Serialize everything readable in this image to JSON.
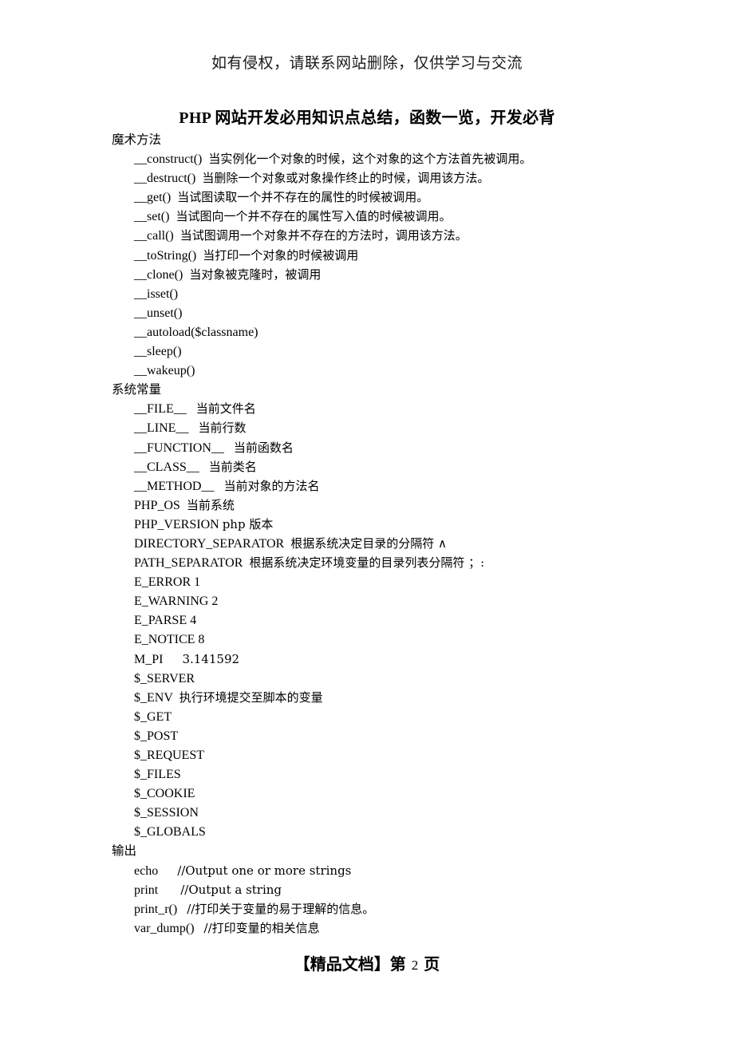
{
  "watermark": "如有侵权，请联系网站删除，仅供学习与交流",
  "title": "PHP 网站开发必用知识点总结，函数一览，开发必背",
  "sections": [
    {
      "heading": "魔术方法",
      "items": [
        {
          "term": "__construct()",
          "gap": "  ",
          "desc": "当实例化一个对象的时候，这个对象的这个方法首先被调用。"
        },
        {
          "term": "__destruct()",
          "gap": "  ",
          "desc": "当删除一个对象或对象操作终止的时候，调用该方法。"
        },
        {
          "term": "__get()",
          "gap": "  ",
          "desc": "当试图读取一个并不存在的属性的时候被调用。"
        },
        {
          "term": "__set()",
          "gap": "  ",
          "desc": "当试图向一个并不存在的属性写入值的时候被调用。"
        },
        {
          "term": "__call()",
          "gap": "  ",
          "desc": "当试图调用一个对象并不存在的方法时，调用该方法。"
        },
        {
          "term": "__toString()",
          "gap": "  ",
          "desc": "当打印一个对象的时候被调用"
        },
        {
          "term": "__clone()",
          "gap": "  ",
          "desc": "当对象被克隆时，被调用"
        },
        {
          "term": "__isset()",
          "gap": "",
          "desc": ""
        },
        {
          "term": "__unset()",
          "gap": "",
          "desc": ""
        },
        {
          "term": "__autoload($classname)",
          "gap": "",
          "desc": ""
        },
        {
          "term": "__sleep()",
          "gap": "",
          "desc": ""
        },
        {
          "term": "__wakeup()",
          "gap": "",
          "desc": ""
        }
      ]
    },
    {
      "heading": "系统常量",
      "items": [
        {
          "term": "__FILE__",
          "gap": "   ",
          "desc": "当前文件名"
        },
        {
          "term": "__LINE__",
          "gap": "   ",
          "desc": "当前行数"
        },
        {
          "term": "__FUNCTION__",
          "gap": "   ",
          "desc": "当前函数名"
        },
        {
          "term": "__CLASS__",
          "gap": "   ",
          "desc": "当前类名"
        },
        {
          "term": "__METHOD__",
          "gap": "   ",
          "desc": "当前对象的方法名"
        },
        {
          "term": "PHP_OS",
          "gap": "  ",
          "desc": "当前系统"
        },
        {
          "term": "PHP_VERSION",
          "gap": " ",
          "desc": "php 版本"
        },
        {
          "term": "DIRECTORY_SEPARATOR",
          "gap": "  ",
          "desc": "根据系统决定目录的分隔符 ∧"
        },
        {
          "term": "PATH_SEPARATOR",
          "gap": "  ",
          "desc": "根据系统决定环境变量的目录列表分隔符 ；:"
        },
        {
          "term": "E_ERROR 1",
          "gap": "",
          "desc": ""
        },
        {
          "term": "E_WARNING 2",
          "gap": "",
          "desc": ""
        },
        {
          "term": "E_PARSE 4",
          "gap": "",
          "desc": ""
        },
        {
          "term": "E_NOTICE 8",
          "gap": "",
          "desc": ""
        },
        {
          "term": "M_PI",
          "gap": "      ",
          "desc": "3.141592"
        },
        {
          "term": "$_SERVER",
          "gap": "",
          "desc": ""
        },
        {
          "term": "$_ENV",
          "gap": "  ",
          "desc": "执行环境提交至脚本的变量"
        },
        {
          "term": "$_GET",
          "gap": "",
          "desc": ""
        },
        {
          "term": "$_POST",
          "gap": "",
          "desc": ""
        },
        {
          "term": "$_REQUEST",
          "gap": "",
          "desc": ""
        },
        {
          "term": "$_FILES",
          "gap": "",
          "desc": ""
        },
        {
          "term": "$_COOKIE",
          "gap": "",
          "desc": ""
        },
        {
          "term": "$_SESSION",
          "gap": "",
          "desc": ""
        },
        {
          "term": "$_GLOBALS",
          "gap": "",
          "desc": ""
        }
      ]
    },
    {
      "heading": "输出",
      "items": [
        {
          "term": "echo",
          "gap": "      ",
          "desc": "//Output one or more strings"
        },
        {
          "term": "print",
          "gap": "       ",
          "desc": "//Output a string"
        },
        {
          "term": "print_r()",
          "gap": "   ",
          "desc": "//打印关于变量的易于理解的信息。"
        },
        {
          "term": "var_dump()",
          "gap": "   ",
          "desc": "//打印变量的相关信息"
        }
      ]
    }
  ],
  "footer": {
    "prefix": "【精品文档】第",
    "page": "2",
    "suffix": "页"
  }
}
